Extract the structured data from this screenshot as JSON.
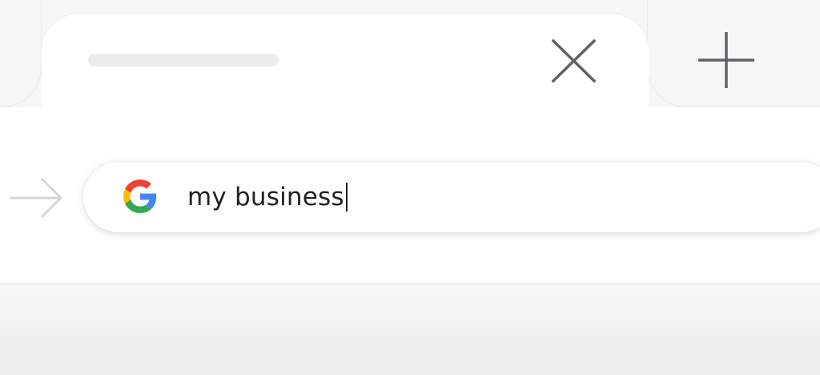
{
  "tabs": {
    "active_tab": {
      "title_visible": false,
      "close_icon": "close-icon"
    },
    "new_tab_icon": "plus-icon"
  },
  "toolbar": {
    "forward_icon": "arrow-right-icon"
  },
  "omnibox": {
    "search_engine_icon": "google-g-icon",
    "value": "my business"
  },
  "colors": {
    "google_blue": "#4285F4",
    "google_red": "#EA4335",
    "google_yellow": "#FBBC05",
    "google_green": "#34A853",
    "icon_gray": "#5f6368",
    "forward_gray": "#d6d6d6"
  }
}
